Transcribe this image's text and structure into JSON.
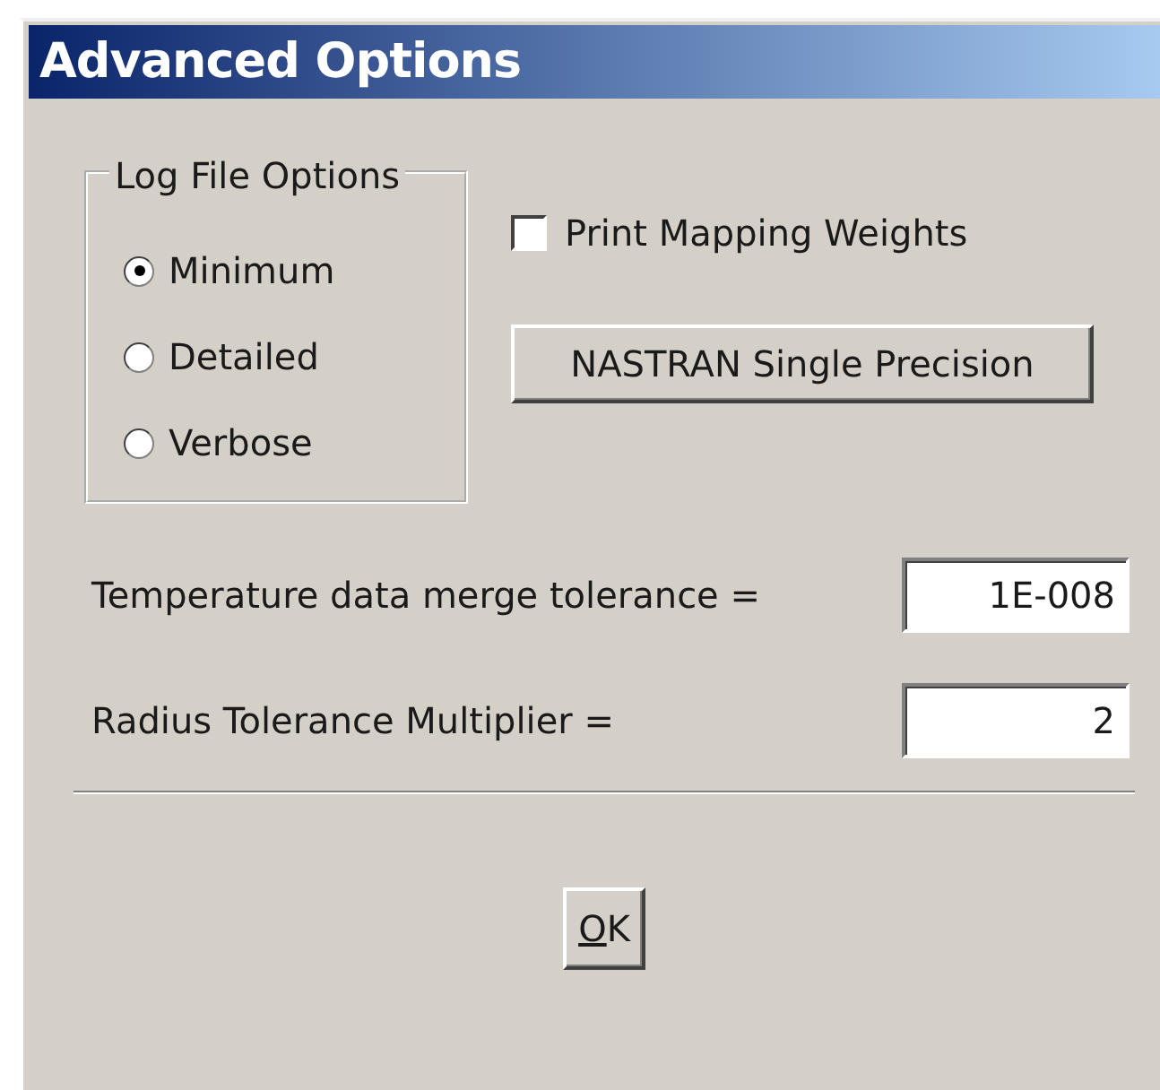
{
  "window": {
    "title": "Advanced Options"
  },
  "log_file_options": {
    "label": "Log File Options",
    "options": [
      {
        "label": "Minimum",
        "selected": true
      },
      {
        "label": "Detailed",
        "selected": false
      },
      {
        "label": "Verbose",
        "selected": false
      }
    ]
  },
  "print_mapping_weights": {
    "label": "Print Mapping Weights",
    "checked": false
  },
  "nastran_button": {
    "label": "NASTRAN Single Precision"
  },
  "fields": [
    {
      "label": "Temperature data merge tolerance =",
      "value": "1E-008"
    },
    {
      "label": "Radius Tolerance Multiplier =",
      "value": "2"
    }
  ],
  "ok_button": {
    "label_parts": [
      {
        "text": "O",
        "underlined": true
      },
      {
        "text": "K",
        "underlined": false
      }
    ]
  }
}
